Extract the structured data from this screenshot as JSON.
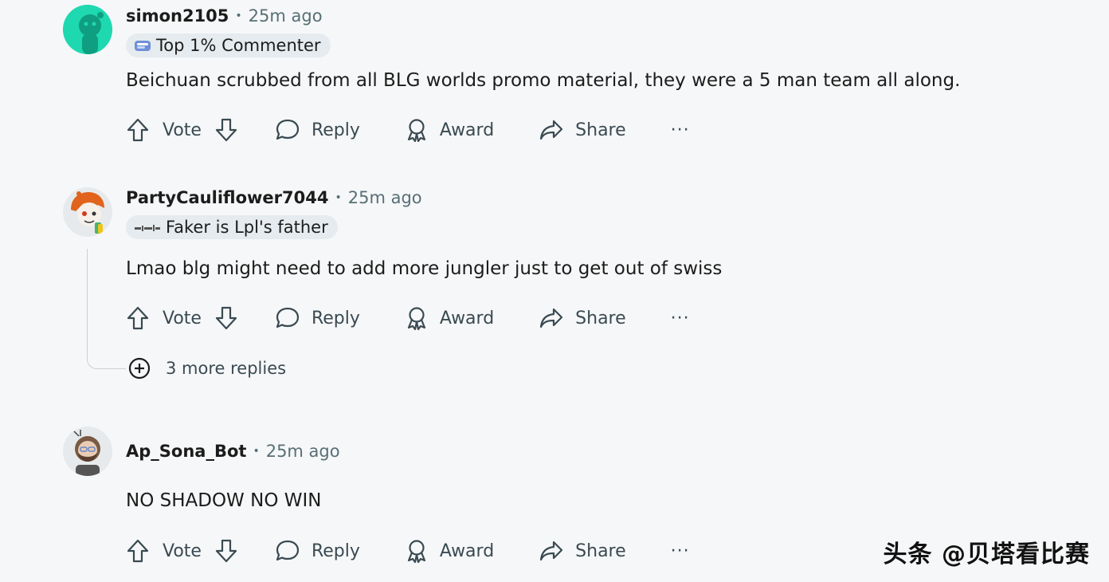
{
  "comments": [
    {
      "username": "simon2105",
      "time": "25m ago",
      "flair": "Top 1% Commenter",
      "text": "Beichuan scrubbed from all BLG worlds promo material, they were a 5 man team all along.",
      "actions": {
        "vote": "Vote",
        "reply": "Reply",
        "award": "Award",
        "share": "Share",
        "more": "···"
      }
    },
    {
      "username": "PartyCauliflower7044",
      "time": "25m ago",
      "flair": "Faker is Lpl's father",
      "text": "Lmao blg might need to add more jungler just to get out of swiss",
      "actions": {
        "vote": "Vote",
        "reply": "Reply",
        "award": "Award",
        "share": "Share",
        "more": "···"
      },
      "more_replies": "3 more replies"
    },
    {
      "username": "Ap_Sona_Bot",
      "time": "25m ago",
      "text": "NO SHADOW NO WIN",
      "actions": {
        "vote": "Vote",
        "reply": "Reply",
        "award": "Award",
        "share": "Share",
        "more": "···"
      }
    }
  ],
  "watermark": "头条 @贝塔看比赛",
  "colors": {
    "background": "#f6f7f8",
    "meta": "#576f76",
    "flair_bg": "#e5ebee",
    "avatar1": "#1ed8b0"
  }
}
